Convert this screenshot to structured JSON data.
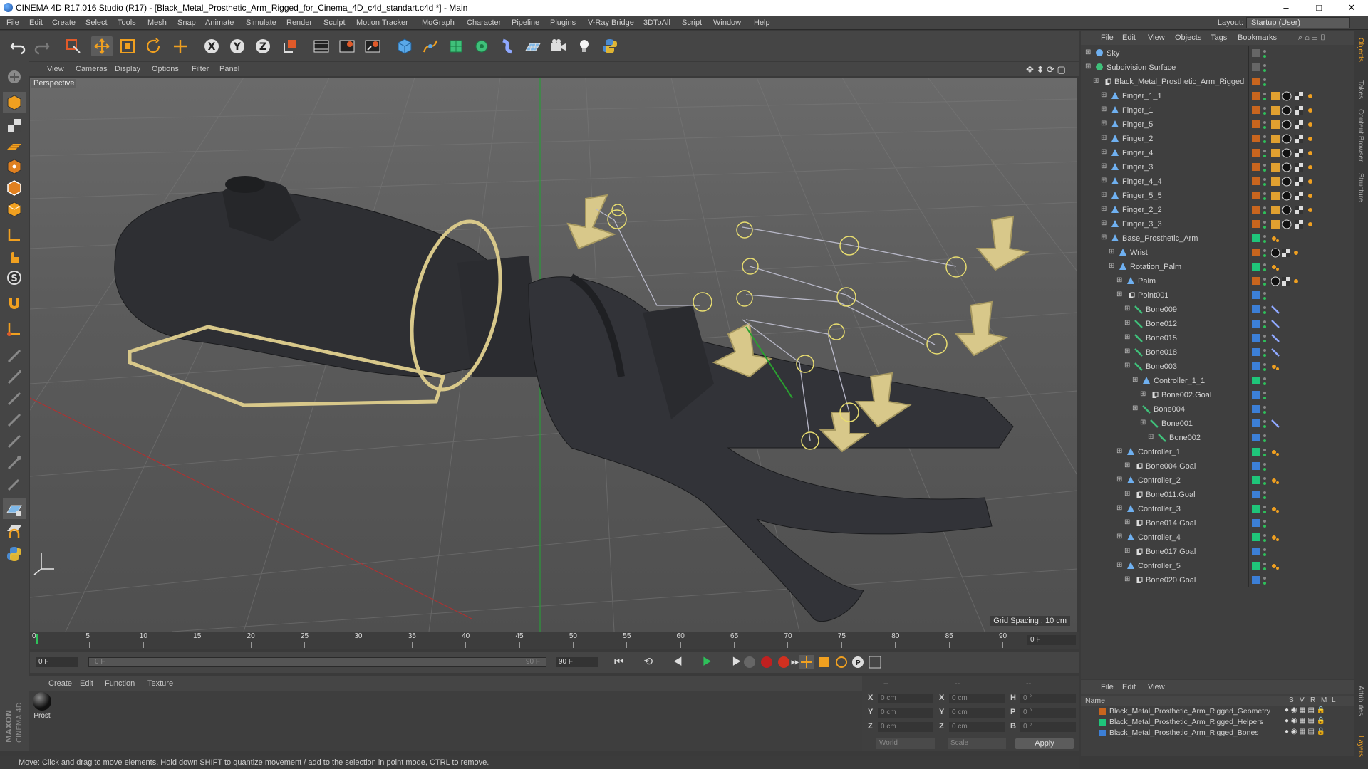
{
  "window": {
    "title": "CINEMA 4D R17.016 Studio (R17) - [Black_Metal_Prosthetic_Arm_Rigged_for_Cinema_4D_c4d_standart.c4d *] - Main",
    "controls": [
      "–",
      "□",
      "✕"
    ]
  },
  "menubar": {
    "items": [
      "File",
      "Edit",
      "Create",
      "Select",
      "Tools",
      "Mesh",
      "Snap",
      "Animate",
      "Simulate",
      "Render",
      "Sculpt",
      "Motion Tracker",
      "MoGraph",
      "Character",
      "Pipeline",
      "Plugins",
      "V-Ray Bridge",
      "3DToAll",
      "Script",
      "Window",
      "Help"
    ],
    "layout_label": "Layout:",
    "layout_value": "Startup (User)"
  },
  "toolbar": {
    "icons": [
      "undo-icon",
      "redo-icon",
      "live-selection-icon",
      "move-icon",
      "scale-icon",
      "rotate-icon",
      "last-tool-icon",
      "x-axis-icon",
      "y-axis-icon",
      "z-axis-icon",
      "coordinate-system-icon",
      "render-view-icon",
      "render-picture-viewer-icon",
      "edit-render-settings-icon",
      "cube-icon",
      "pen-icon",
      "subdivision-icon",
      "array-icon",
      "deformer-icon",
      "floor-icon",
      "camera-icon",
      "light-icon",
      "python-icon"
    ],
    "axis_labels": [
      "X",
      "Y",
      "Z"
    ]
  },
  "viewport": {
    "menu": [
      "View",
      "Cameras",
      "Display",
      "Options",
      "Filter",
      "Panel"
    ],
    "label": "Perspective",
    "grid_spacing": "Grid Spacing : 10 cm"
  },
  "timeline": {
    "ticks": [
      "0",
      "5",
      "10",
      "15",
      "20",
      "25",
      "30",
      "35",
      "40",
      "45",
      "50",
      "55",
      "60",
      "65",
      "70",
      "75",
      "80",
      "85",
      "90"
    ],
    "current_frame_field": "0 F",
    "start_field": "0 F",
    "slider_start": "0 F",
    "slider_end": "90 F",
    "end_field": "90 F"
  },
  "material_manager": {
    "menu": [
      "Create",
      "Edit",
      "Function",
      "Texture"
    ],
    "materials": [
      {
        "name": "Prost"
      }
    ]
  },
  "coordinates": {
    "header": [
      "--",
      "--",
      "--"
    ],
    "rows": [
      {
        "a": "X",
        "av": "0 cm",
        "b": "X",
        "bv": "0 cm",
        "c": "H",
        "cv": "0 °"
      },
      {
        "a": "Y",
        "av": "0 cm",
        "b": "Y",
        "bv": "0 cm",
        "c": "P",
        "cv": "0 °"
      },
      {
        "a": "Z",
        "av": "0 cm",
        "b": "Z",
        "bv": "0 cm",
        "c": "B",
        "cv": "0 °"
      }
    ],
    "mode": "World",
    "scale_mode": "Scale",
    "apply": "Apply"
  },
  "status": "Move: Click and drag to move elements. Hold down SHIFT to quantize movement / add to the selection in point mode, CTRL to remove.",
  "object_manager": {
    "menu": [
      "File",
      "Edit",
      "View",
      "Objects",
      "Tags",
      "Bookmarks"
    ],
    "objects": [
      {
        "name": "Sky",
        "indent": 0,
        "color": "",
        "type": "sky",
        "tags": ""
      },
      {
        "name": "Subdivision Surface",
        "indent": 0,
        "color": "",
        "type": "subdiv",
        "tags": ""
      },
      {
        "name": "Black_Metal_Prosthetic_Arm_Rigged",
        "indent": 1,
        "color": "#c8651e",
        "type": "null",
        "tags": ""
      },
      {
        "name": "Finger_1_1",
        "indent": 2,
        "color": "#c8651e",
        "type": "joint",
        "tags": "mat"
      },
      {
        "name": "Finger_1",
        "indent": 2,
        "color": "#c8651e",
        "type": "joint",
        "tags": "mat"
      },
      {
        "name": "Finger_5",
        "indent": 2,
        "color": "#c8651e",
        "type": "joint",
        "tags": "mat"
      },
      {
        "name": "Finger_2",
        "indent": 2,
        "color": "#c8651e",
        "type": "joint",
        "tags": "mat"
      },
      {
        "name": "Finger_4",
        "indent": 2,
        "color": "#c8651e",
        "type": "joint",
        "tags": "mat"
      },
      {
        "name": "Finger_3",
        "indent": 2,
        "color": "#c8651e",
        "type": "joint",
        "tags": "mat"
      },
      {
        "name": "Finger_4_4",
        "indent": 2,
        "color": "#c8651e",
        "type": "joint",
        "tags": "mat"
      },
      {
        "name": "Finger_5_5",
        "indent": 2,
        "color": "#c8651e",
        "type": "joint",
        "tags": "mat"
      },
      {
        "name": "Finger_2_2",
        "indent": 2,
        "color": "#c8651e",
        "type": "joint",
        "tags": "mat"
      },
      {
        "name": "Finger_3_3",
        "indent": 2,
        "color": "#c8651e",
        "type": "joint",
        "tags": "mat"
      },
      {
        "name": "Base_Prosthetic_Arm",
        "indent": 2,
        "color": "#1fc57a",
        "type": "joint",
        "tags": "ik"
      },
      {
        "name": "Wrist",
        "indent": 3,
        "color": "#c8651e",
        "type": "joint",
        "tags": "mat2"
      },
      {
        "name": "Rotation_Palm",
        "indent": 3,
        "color": "#1fc57a",
        "type": "joint",
        "tags": "ik"
      },
      {
        "name": "Palm",
        "indent": 4,
        "color": "#c8651e",
        "type": "joint",
        "tags": "mat2"
      },
      {
        "name": "Point001",
        "indent": 4,
        "color": "#3c7fd6",
        "type": "null",
        "tags": ""
      },
      {
        "name": "Bone009",
        "indent": 5,
        "color": "#3c7fd6",
        "type": "bone",
        "tags": "bone"
      },
      {
        "name": "Bone012",
        "indent": 5,
        "color": "#3c7fd6",
        "type": "bone",
        "tags": "bone"
      },
      {
        "name": "Bone015",
        "indent": 5,
        "color": "#3c7fd6",
        "type": "bone",
        "tags": "bone"
      },
      {
        "name": "Bone018",
        "indent": 5,
        "color": "#3c7fd6",
        "type": "bone",
        "tags": "bone"
      },
      {
        "name": "Bone003",
        "indent": 5,
        "color": "#3c7fd6",
        "type": "bone",
        "tags": "ik"
      },
      {
        "name": "Controller_1_1",
        "indent": 6,
        "color": "#1fc57a",
        "type": "joint",
        "tags": ""
      },
      {
        "name": "Bone002.Goal",
        "indent": 7,
        "color": "#3c7fd6",
        "type": "null",
        "tags": ""
      },
      {
        "name": "Bone004",
        "indent": 6,
        "color": "#3c7fd6",
        "type": "bone",
        "tags": ""
      },
      {
        "name": "Bone001",
        "indent": 7,
        "color": "#3c7fd6",
        "type": "bone",
        "tags": "bone"
      },
      {
        "name": "Bone002",
        "indent": 8,
        "color": "#3c7fd6",
        "type": "bone",
        "tags": ""
      },
      {
        "name": "Controller_1",
        "indent": 4,
        "color": "#1fc57a",
        "type": "joint",
        "tags": "ik"
      },
      {
        "name": "Bone004.Goal",
        "indent": 5,
        "color": "#3c7fd6",
        "type": "null",
        "tags": ""
      },
      {
        "name": "Controller_2",
        "indent": 4,
        "color": "#1fc57a",
        "type": "joint",
        "tags": "ik"
      },
      {
        "name": "Bone011.Goal",
        "indent": 5,
        "color": "#3c7fd6",
        "type": "null",
        "tags": ""
      },
      {
        "name": "Controller_3",
        "indent": 4,
        "color": "#1fc57a",
        "type": "joint",
        "tags": "ik"
      },
      {
        "name": "Bone014.Goal",
        "indent": 5,
        "color": "#3c7fd6",
        "type": "null",
        "tags": ""
      },
      {
        "name": "Controller_4",
        "indent": 4,
        "color": "#1fc57a",
        "type": "joint",
        "tags": "ik"
      },
      {
        "name": "Bone017.Goal",
        "indent": 5,
        "color": "#3c7fd6",
        "type": "null",
        "tags": ""
      },
      {
        "name": "Controller_5",
        "indent": 4,
        "color": "#1fc57a",
        "type": "joint",
        "tags": "ik"
      },
      {
        "name": "Bone020.Goal",
        "indent": 5,
        "color": "#3c7fd6",
        "type": "null",
        "tags": ""
      }
    ]
  },
  "layer_manager": {
    "menu": [
      "File",
      "Edit",
      "View"
    ],
    "header": {
      "name": "Name",
      "cols": [
        "S",
        "V",
        "R",
        "M",
        "L"
      ]
    },
    "layers": [
      {
        "name": "Black_Metal_Prosthetic_Arm_Rigged_Geometry",
        "color": "#c8651e"
      },
      {
        "name": "Black_Metal_Prosthetic_Arm_Rigged_Helpers",
        "color": "#1fc57a"
      },
      {
        "name": "Black_Metal_Prosthetic_Arm_Rigged_Bones",
        "color": "#3c7fd6"
      }
    ]
  },
  "right_tabs": [
    "Objects",
    "Takes",
    "Content Browser",
    "Structure",
    "Attributes",
    "Layers"
  ],
  "brand": "MAXON CINEMA 4D"
}
